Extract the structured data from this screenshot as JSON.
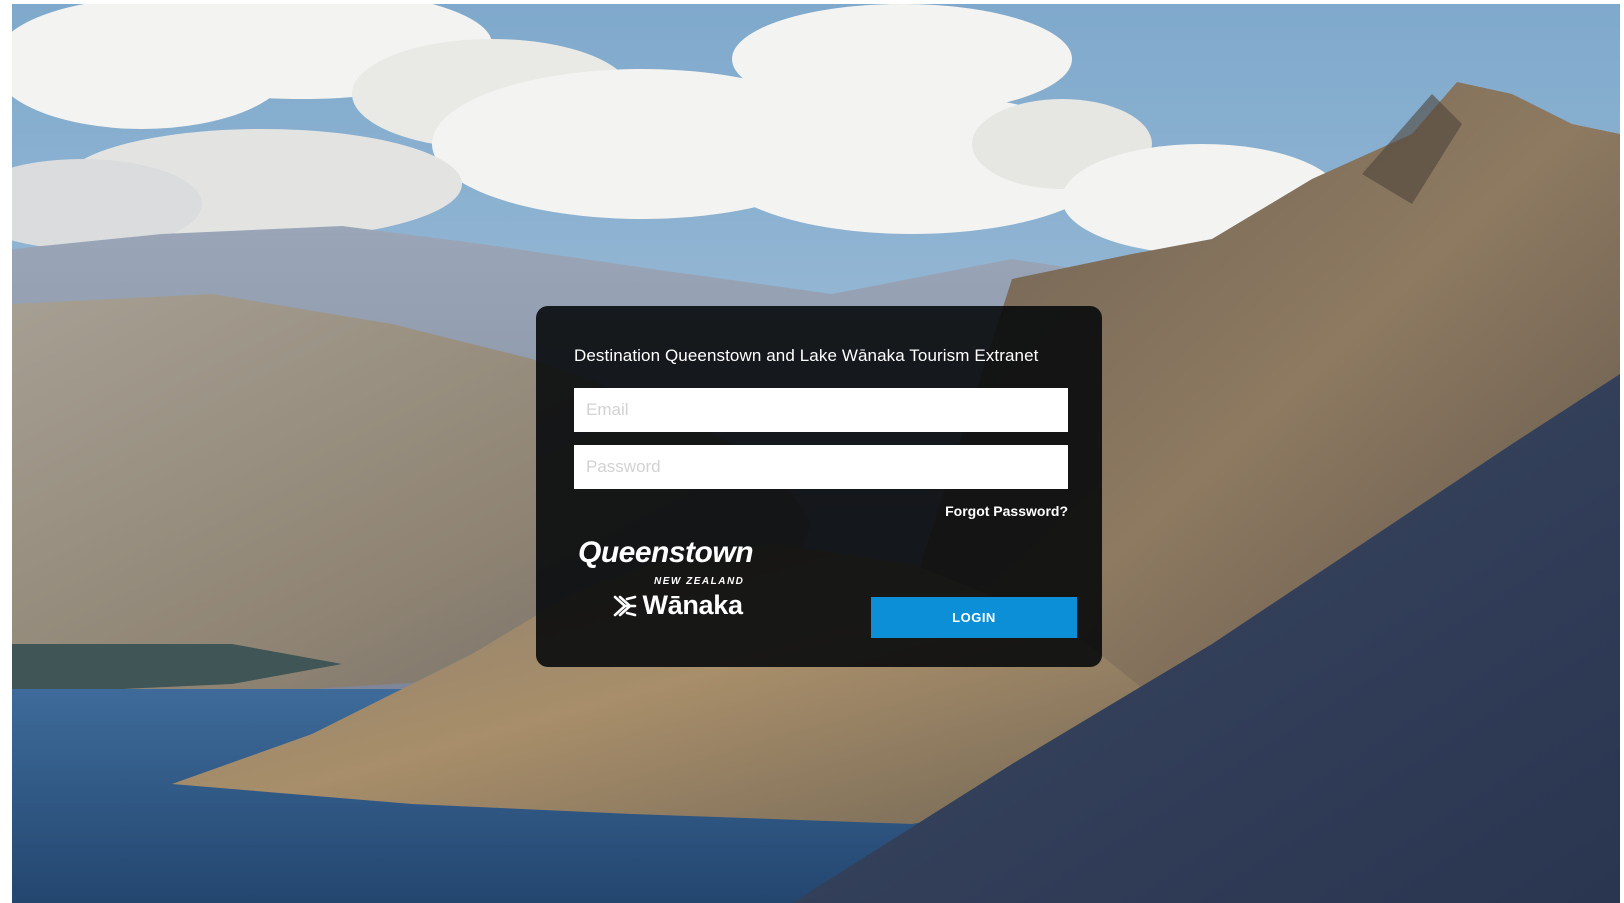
{
  "login": {
    "title": "Destination Queenstown and Lake Wānaka Tourism Extranet",
    "email_placeholder": "Email",
    "password_placeholder": "Password",
    "forgot_label": "Forgot Password?",
    "login_label": "LOGIN",
    "accent_color": "#0c8fd6"
  },
  "logos": {
    "queenstown": "Queenstown",
    "new_zealand": "NEW ZEALAND",
    "wanaka": "Wānaka",
    "wanaka_icon": "wanaka-mark-icon"
  }
}
